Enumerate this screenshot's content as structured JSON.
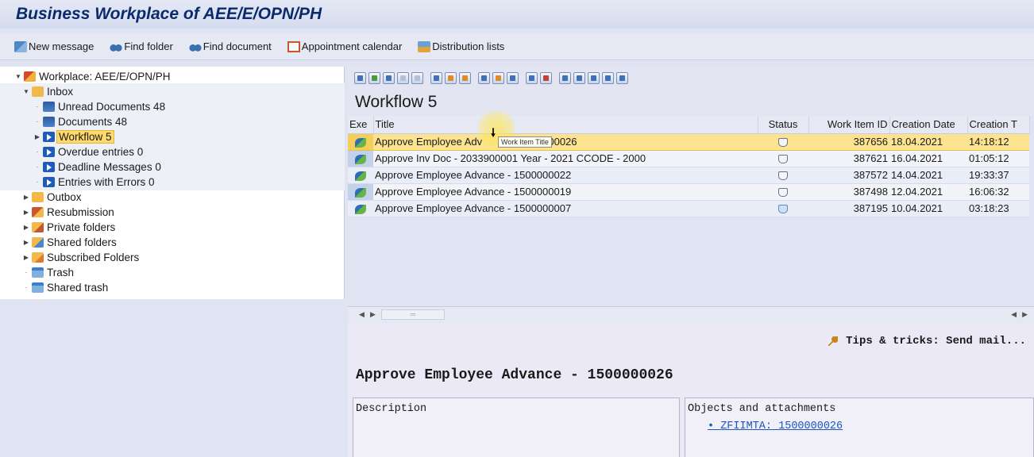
{
  "window": {
    "title": "Business Workplace of AEE/E/OPN/PH"
  },
  "appbar": {
    "items": [
      {
        "label": "New message",
        "icon": "new-message-icon"
      },
      {
        "label": "Find folder",
        "icon": "binoculars-icon"
      },
      {
        "label": "Find document",
        "icon": "binoculars-icon"
      },
      {
        "label": "Appointment calendar",
        "icon": "calendar-icon"
      },
      {
        "label": "Distribution lists",
        "icon": "distribution-list-icon"
      }
    ]
  },
  "tree": {
    "root": "Workplace: AEE/E/OPN/PH",
    "inbox": "Inbox",
    "unread": "Unread Documents 48",
    "documents": "Documents 48",
    "workflow": "Workflow 5",
    "overdue": "Overdue entries 0",
    "deadline": "Deadline Messages 0",
    "errors": "Entries with Errors 0",
    "outbox": "Outbox",
    "resubmission": "Resubmission",
    "private": "Private folders",
    "shared": "Shared folders",
    "subscribed": "Subscribed Folders",
    "trash": "Trash",
    "shared_trash": "Shared trash"
  },
  "main": {
    "heading": "Workflow 5",
    "columns": {
      "exe": "Exe",
      "title": "Title",
      "status": "Status",
      "work_item_id": "Work Item ID",
      "creation_date": "Creation Date",
      "creation_time": "Creation T"
    },
    "rows": [
      {
        "title": "Approve Employee Adv",
        "title_tail": "000026",
        "id": "387656",
        "date": "18.04.2021",
        "time": "14:18:12"
      },
      {
        "title": "Approve Inv Doc - 2033900001 Year - 2021 CCODE - 2000",
        "title_tail": "",
        "id": "387621",
        "date": "16.04.2021",
        "time": "01:05:12"
      },
      {
        "title": "Approve Employee Advance - 1500000022",
        "title_tail": "",
        "id": "387572",
        "date": "14.04.2021",
        "time": "19:33:37"
      },
      {
        "title": "Approve Employee Advance - 1500000019",
        "title_tail": "",
        "id": "387498",
        "date": "12.04.2021",
        "time": "16:06:32"
      },
      {
        "title": "Approve Employee Advance - 1500000007",
        "title_tail": "",
        "id": "387195",
        "date": "10.04.2021",
        "time": "03:18:23"
      }
    ],
    "tooltip": "Work Item Title"
  },
  "preview": {
    "tips": "Tips & tricks:  Send mail...",
    "title": "Approve Employee Advance - 1500000026",
    "description_label": "Description",
    "objects_label": "Objects and attachments",
    "object_link": "ZFIIMTA: 1500000026"
  },
  "colors": {
    "title_text": "#0a2a6b",
    "selection": "#fbe390",
    "link": "#1a56c4"
  }
}
